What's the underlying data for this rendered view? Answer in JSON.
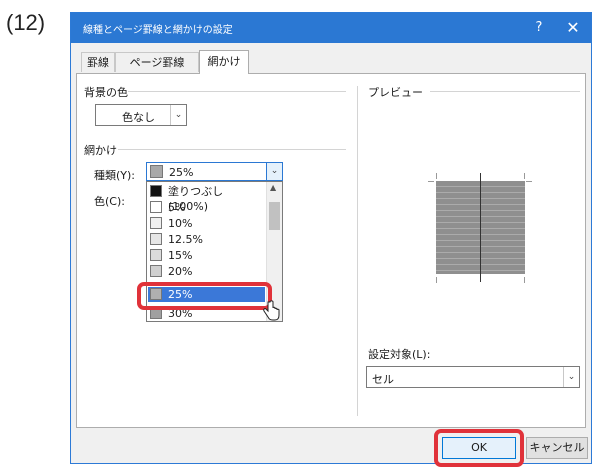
{
  "step_label": "(12)",
  "dialog": {
    "title": "線種とページ罫線と網かけの設定",
    "help_label": "?",
    "close_label": "✕"
  },
  "tabs": [
    {
      "label": "罫線",
      "active": false
    },
    {
      "label": "ページ罫線",
      "active": false
    },
    {
      "label": "網かけ",
      "active": true
    }
  ],
  "background_section": {
    "title": "背景の色",
    "color_button_label": "色なし"
  },
  "shading_section": {
    "title": "網かけ",
    "type_label": "種類(Y):",
    "type_value": "25%",
    "color_label": "色(C):"
  },
  "dropdown": {
    "items": [
      {
        "label": "塗りつぶし (100%)",
        "swatch": "#111111"
      },
      {
        "label": "5%",
        "swatch": "#ffffff"
      },
      {
        "label": "10%",
        "swatch": "#f0f0f0"
      },
      {
        "label": "12.5%",
        "swatch": "#e6e6e6"
      },
      {
        "label": "15%",
        "swatch": "#dcdcdc"
      },
      {
        "label": "20%",
        "swatch": "#d0d0d0"
      },
      {
        "label": "25%",
        "swatch": "#b0b0b0",
        "selected": true
      },
      {
        "label": "30%",
        "swatch": "#a0a0a0"
      }
    ]
  },
  "preview_section": {
    "title": "プレビュー"
  },
  "apply_to": {
    "label": "設定対象(L):",
    "value": "セル"
  },
  "buttons": {
    "ok": "OK",
    "cancel": "キャンセル"
  },
  "colors": {
    "titlebar": "#2b78d3",
    "selection": "#3b78d8",
    "highlight": "#e0323a"
  }
}
